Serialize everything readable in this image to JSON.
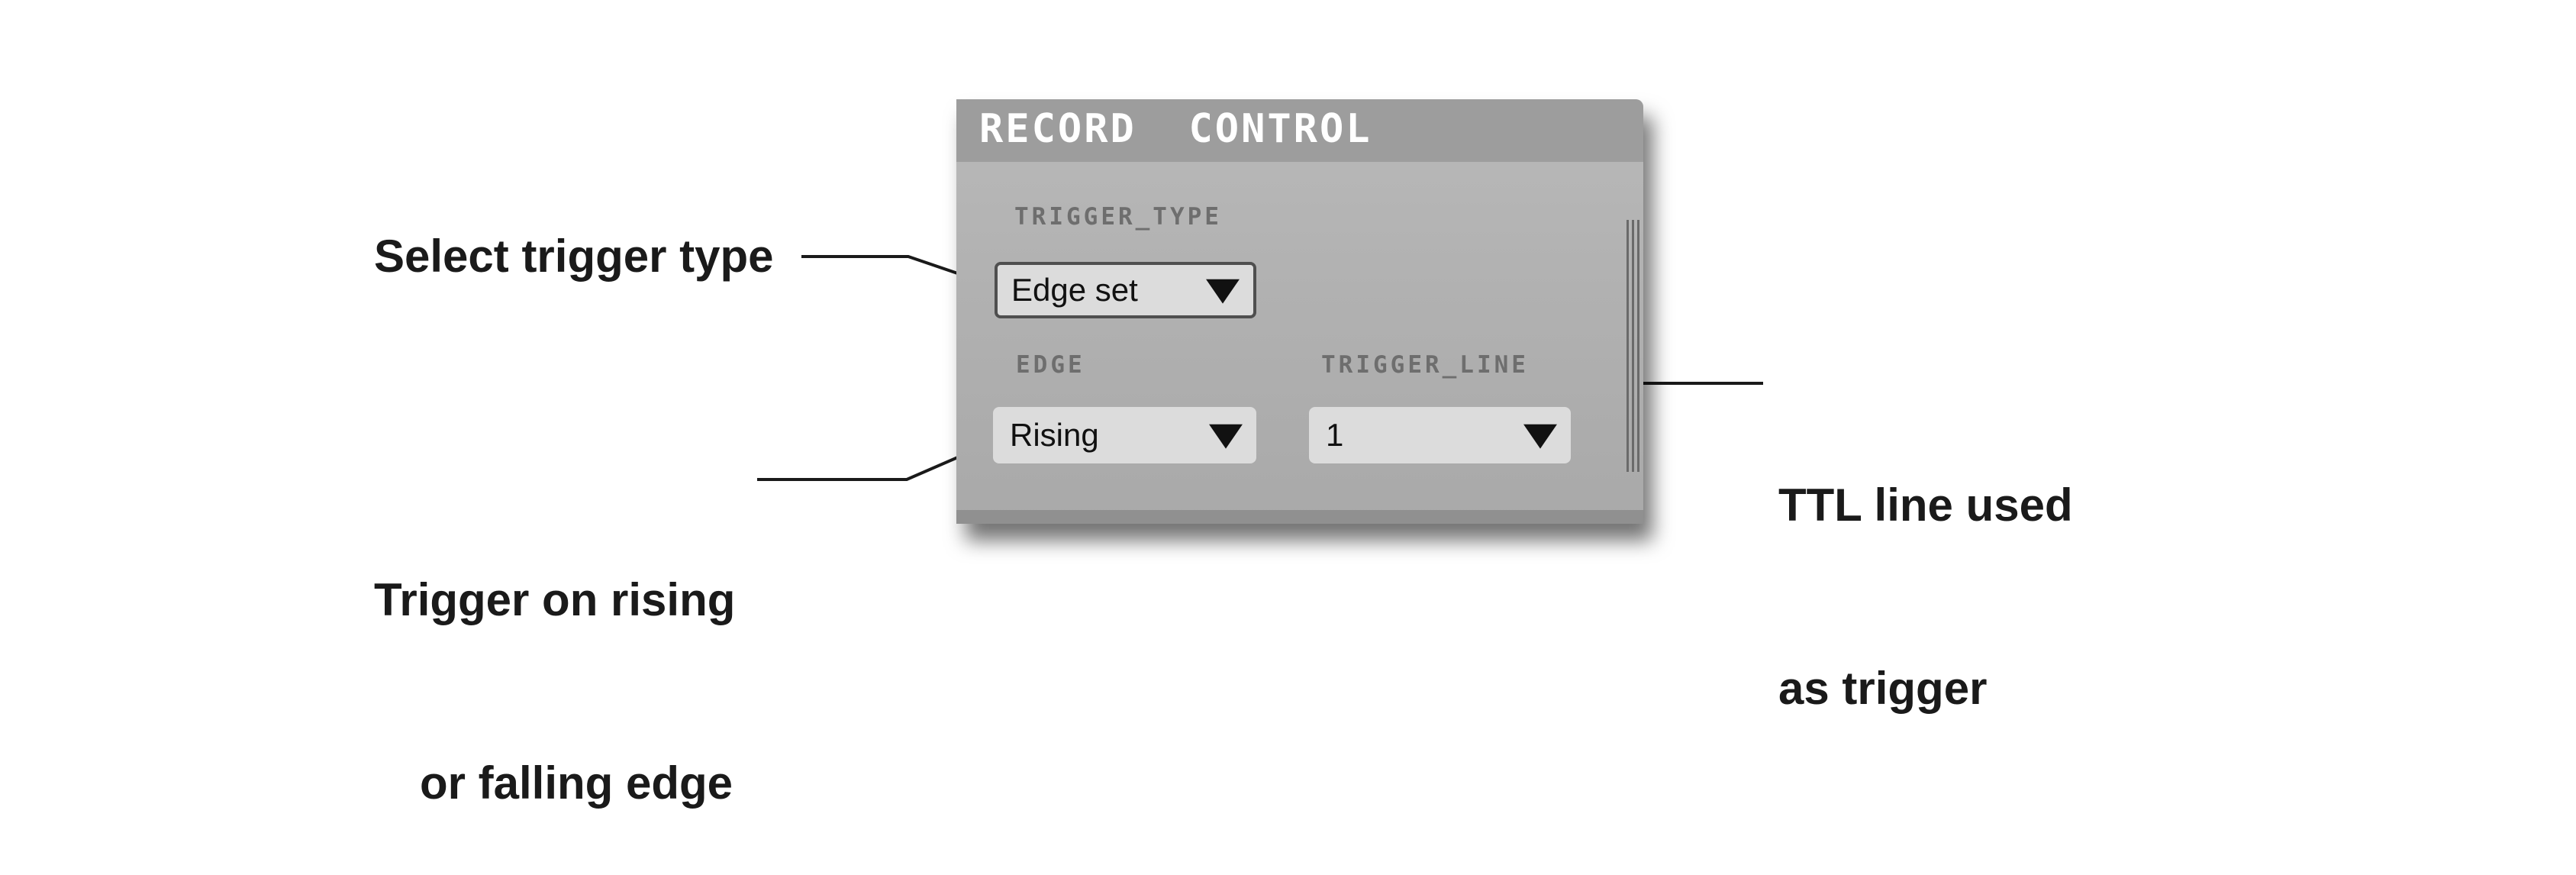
{
  "panel": {
    "title": "RECORD  CONTROL",
    "trigger_type": {
      "label": "TRIGGER_TYPE",
      "value": "Edge set"
    },
    "edge": {
      "label": "EDGE",
      "value": "Rising"
    },
    "trigger_line": {
      "label": "TRIGGER_LINE",
      "value": "1"
    },
    "dropdown_icon": "down-triangle-icon"
  },
  "annotations": {
    "select_trigger_type": "Select trigger type",
    "trigger_edge_line1": "Trigger on rising",
    "trigger_edge_line2": "or falling edge",
    "ttl_line1": "TTL line used",
    "ttl_line2": "as trigger"
  },
  "colors": {
    "panel_bg": "#b1b1b1",
    "panel_header": "#9d9d9d",
    "dropdown_bg": "#dcdcdc",
    "label_text": "#6e6e6e",
    "annotation_text": "#1a1a1a"
  }
}
